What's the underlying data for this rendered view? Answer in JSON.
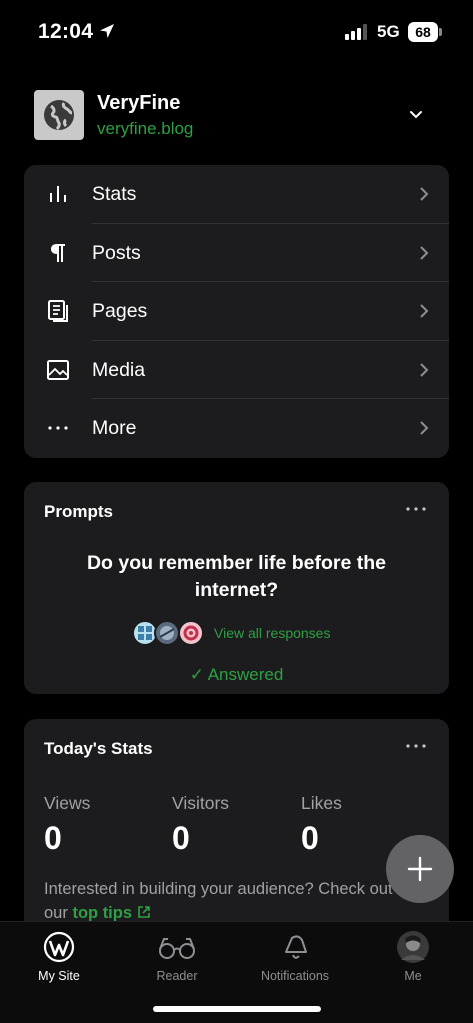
{
  "status_bar": {
    "time": "12:04",
    "network": "5G",
    "battery": "68"
  },
  "site": {
    "name": "VeryFine",
    "url": "veryfine.blog"
  },
  "menu": [
    {
      "label": "Stats",
      "icon": "stats-icon"
    },
    {
      "label": "Posts",
      "icon": "pilcrow-icon"
    },
    {
      "label": "Pages",
      "icon": "pages-icon"
    },
    {
      "label": "Media",
      "icon": "image-icon"
    },
    {
      "label": "More",
      "icon": "more-icon"
    }
  ],
  "prompts": {
    "title": "Prompts",
    "question": "Do you remember life before the internet?",
    "view_all": "View all responses",
    "answered": "✓ Answered"
  },
  "stats": {
    "title": "Today's Stats",
    "items": [
      {
        "label": "Views",
        "value": "0"
      },
      {
        "label": "Visitors",
        "value": "0"
      },
      {
        "label": "Likes",
        "value": "0"
      }
    ],
    "note_prefix": "Interested in building your audience? Check out our",
    "note_link": "top tips"
  },
  "tabs": [
    {
      "label": "My Site",
      "icon": "wordpress-icon",
      "active": true
    },
    {
      "label": "Reader",
      "icon": "glasses-icon",
      "active": false
    },
    {
      "label": "Notifications",
      "icon": "bell-icon",
      "active": false
    },
    {
      "label": "Me",
      "icon": "avatar",
      "active": false
    }
  ],
  "colors": {
    "accent": "#2ea043",
    "card": "#1c1c1e",
    "background": "#000000"
  }
}
